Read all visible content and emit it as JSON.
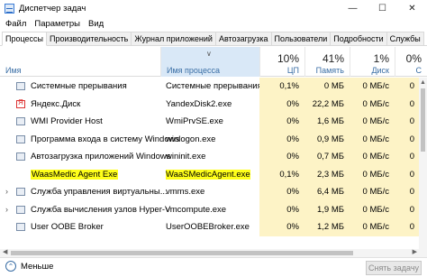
{
  "window": {
    "title": "Диспетчер задач",
    "min_icon": "minimize-icon",
    "max_icon": "maximize-icon",
    "close_icon": "close-icon"
  },
  "menu": [
    "Файл",
    "Параметры",
    "Вид"
  ],
  "tabs": [
    "Процессы",
    "Производительность",
    "Журнал приложений",
    "Автозагрузка",
    "Пользователи",
    "Подробности",
    "Службы"
  ],
  "active_tab": "Процессы",
  "columns": {
    "name": "Имя",
    "process": "Имя процесса",
    "cpu": {
      "percent": "10%",
      "label": "ЦП"
    },
    "memory": {
      "percent": "41%",
      "label": "Память"
    },
    "disk": {
      "percent": "1%",
      "label": "Диск"
    },
    "network": {
      "percent": "0%",
      "label": "С"
    }
  },
  "rows": [
    {
      "name": "Системные прерывания",
      "process": "Системные прерывания",
      "cpu": "0,1%",
      "memory": "0 МБ",
      "disk": "0 МБ/с",
      "net": "0",
      "expandable": false,
      "highlight": false,
      "icon": "system-icon"
    },
    {
      "name": "Яндекс.Диск",
      "process": "YandexDisk2.exe",
      "cpu": "0%",
      "memory": "22,2 МБ",
      "disk": "0 МБ/с",
      "net": "0",
      "expandable": false,
      "highlight": false,
      "icon": "yandex-icon"
    },
    {
      "name": "WMI Provider Host",
      "process": "WmiPrvSE.exe",
      "cpu": "0%",
      "memory": "1,6 МБ",
      "disk": "0 МБ/с",
      "net": "0",
      "expandable": false,
      "highlight": false,
      "icon": "app-icon"
    },
    {
      "name": "Программа входа в систему Windows",
      "process": "winlogon.exe",
      "cpu": "0%",
      "memory": "0,9 МБ",
      "disk": "0 МБ/с",
      "net": "0",
      "expandable": false,
      "highlight": false,
      "icon": "app-icon"
    },
    {
      "name": "Автозагрузка приложений Windows",
      "process": "wininit.exe",
      "cpu": "0%",
      "memory": "0,7 МБ",
      "disk": "0 МБ/с",
      "net": "0",
      "expandable": false,
      "highlight": false,
      "icon": "app-icon"
    },
    {
      "name": "WaasMedic Agent Exe",
      "process": "WaaSMedicAgent.exe",
      "cpu": "0,1%",
      "memory": "2,3 МБ",
      "disk": "0 МБ/с",
      "net": "0",
      "expandable": false,
      "highlight": true,
      "icon": "blank"
    },
    {
      "name": "Служба управления виртуальны...",
      "process": "vmms.exe",
      "cpu": "0%",
      "memory": "6,4 МБ",
      "disk": "0 МБ/с",
      "net": "0",
      "expandable": true,
      "highlight": false,
      "icon": "app-icon"
    },
    {
      "name": "Служба вычисления узлов Hyper-V",
      "process": "vmcompute.exe",
      "cpu": "0%",
      "memory": "1,9 МБ",
      "disk": "0 МБ/с",
      "net": "0",
      "expandable": true,
      "highlight": false,
      "icon": "app-icon"
    },
    {
      "name": "User OOBE Broker",
      "process": "UserOOBEBroker.exe",
      "cpu": "0%",
      "memory": "1,2 МБ",
      "disk": "0 МБ/с",
      "net": "0",
      "expandable": false,
      "highlight": false,
      "icon": "app-icon"
    }
  ],
  "footer": {
    "less_label": "Меньше",
    "end_task_label": "Снять задачу"
  },
  "colors": {
    "highlight": "#ffff1a",
    "cell_bg": "#fdf3c6",
    "sort_col": "#d9e8f7",
    "accent": "#3a6ea5"
  }
}
